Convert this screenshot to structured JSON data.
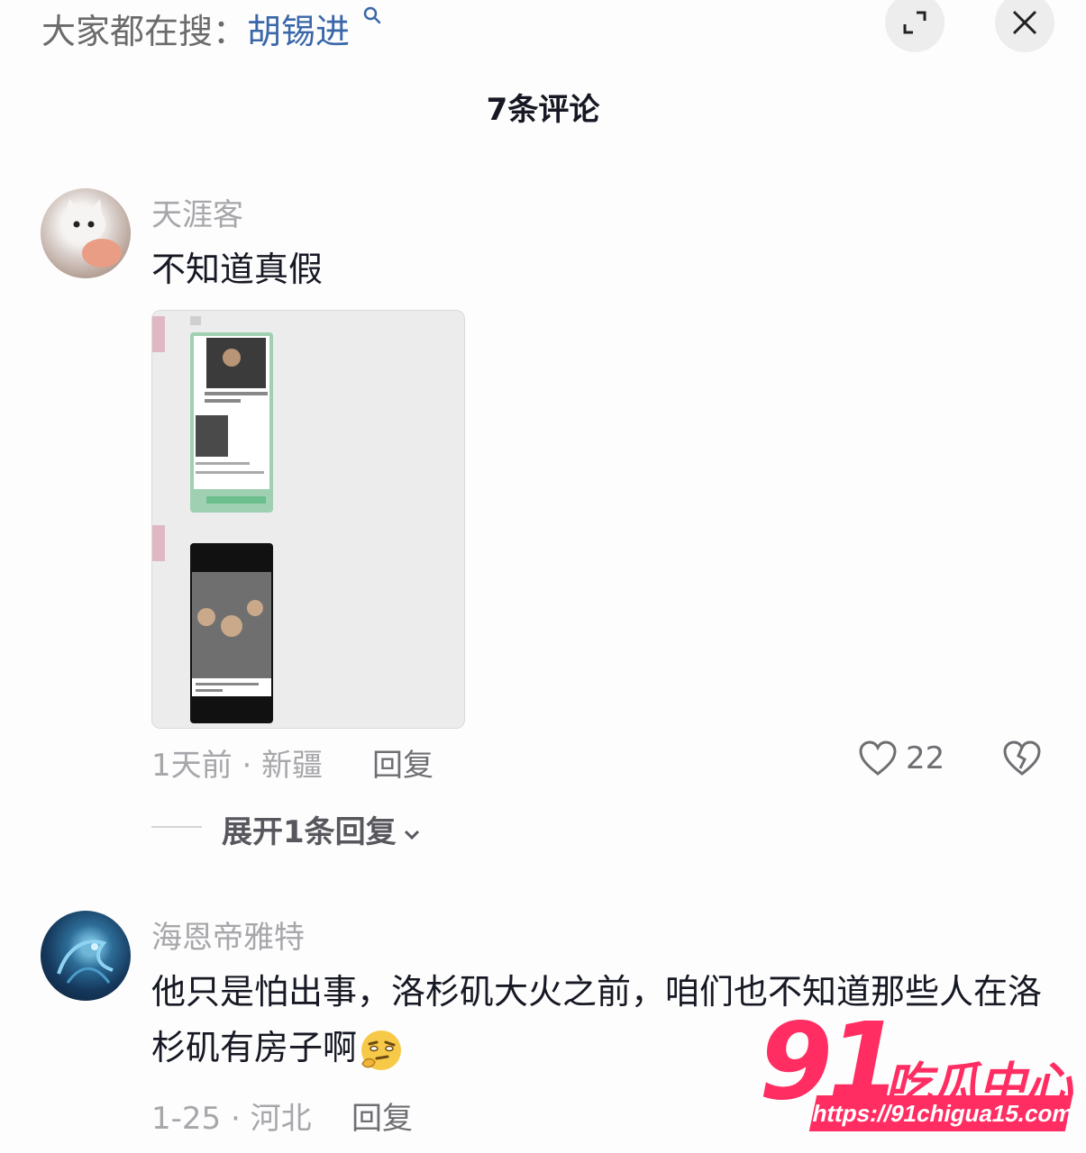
{
  "search": {
    "prefix": "大家都在搜：",
    "keyword": "胡锡进"
  },
  "header": {
    "title": "7条评论"
  },
  "comments": [
    {
      "username": "天涯客",
      "text": "不知道真假",
      "meta": "1天前 · 新疆",
      "reply_label": "回复",
      "likes": "22",
      "expand_label": "展开1条回复"
    },
    {
      "username": "海恩帝雅特",
      "text": "他只是怕出事，洛杉矶大火之前，咱们也不知道那些人在洛杉矶有房子啊",
      "meta": "1-25 · 河北",
      "reply_label": "回复"
    }
  ],
  "watermark": {
    "big": "91",
    "cn": "吃瓜中心",
    "url": "https://91chigua15.com"
  },
  "colors": {
    "accent_link": "#3a67a8",
    "watermark": "#ff2d62",
    "muted": "#a7a7ab"
  },
  "icons": [
    "search-icon",
    "expand-icon",
    "close-icon",
    "heart-icon",
    "broken-heart-icon",
    "chevron-down-icon",
    "thinking-emoji-icon"
  ]
}
